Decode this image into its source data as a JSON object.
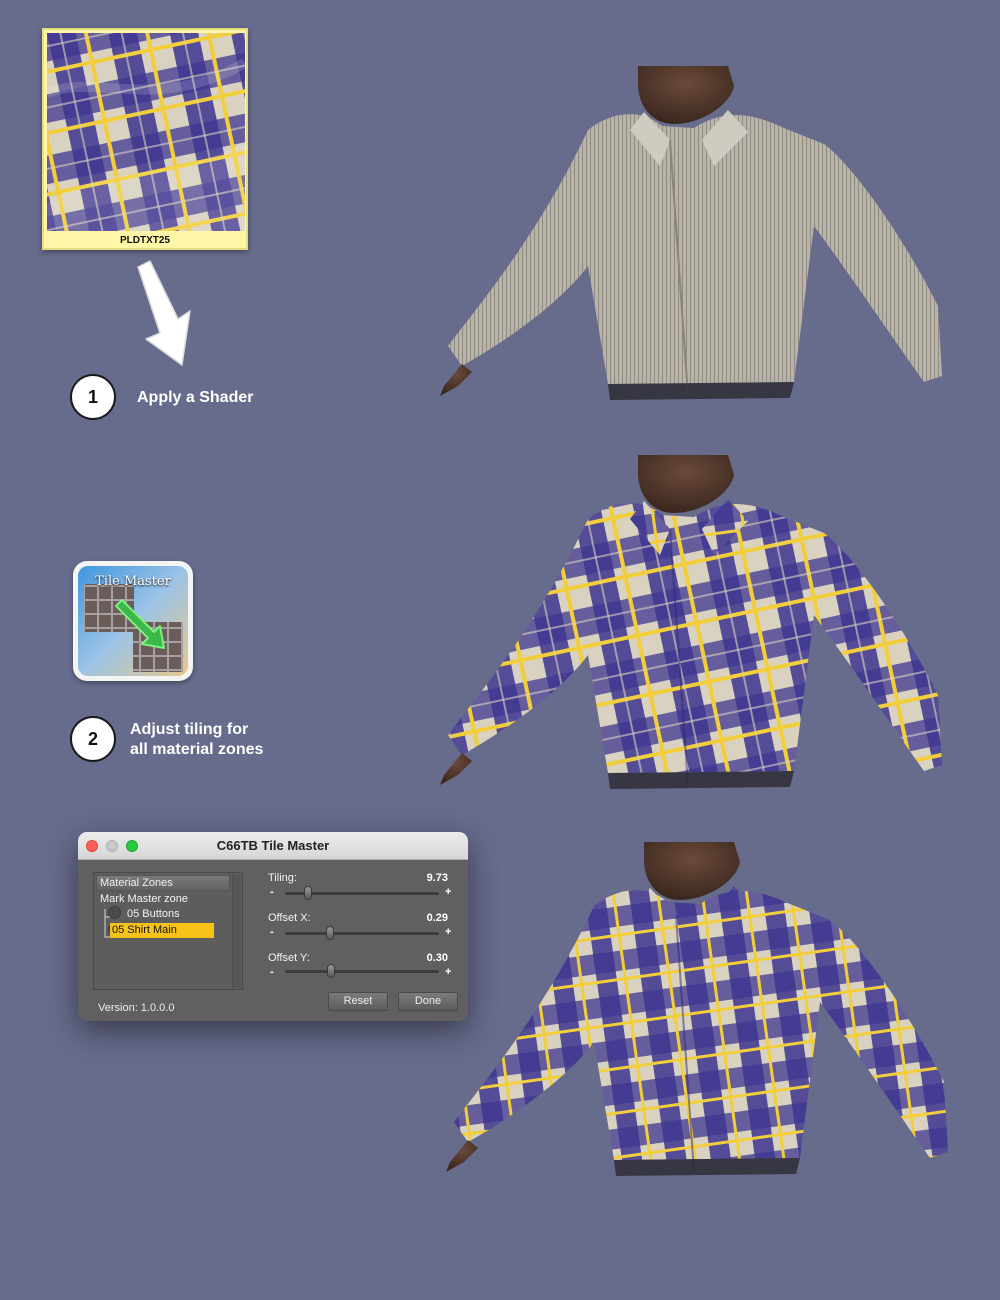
{
  "swatch": {
    "label": "PLDTXT25"
  },
  "steps": [
    {
      "number": "1",
      "text": "Apply a Shader"
    },
    {
      "number": "2",
      "line1": "Adjust tiling for",
      "line2": "all material zones"
    }
  ],
  "app_icon": {
    "title": "Tile Master"
  },
  "dialog": {
    "title": "C66TB Tile Master",
    "zones_header": "Material Zones",
    "mark_master": "Mark Master zone",
    "zones": [
      "05 Buttons",
      "05 Shirt Main"
    ],
    "selected_zone": "05 Shirt Main",
    "sliders": [
      {
        "label": "Tiling:",
        "value": "9.73",
        "fraction": 0.15
      },
      {
        "label": "Offset X:",
        "value": "0.29",
        "fraction": 0.29
      },
      {
        "label": "Offset Y:",
        "value": "0.30",
        "fraction": 0.3
      }
    ],
    "reset_label": "Reset",
    "done_label": "Done",
    "version": "Version: 1.0.0.0"
  },
  "colors": {
    "background": "#676b8c",
    "plaid_purple": "#4a3f9a",
    "plaid_yellow": "#f2cf3a",
    "selection": "#f7c31a"
  }
}
